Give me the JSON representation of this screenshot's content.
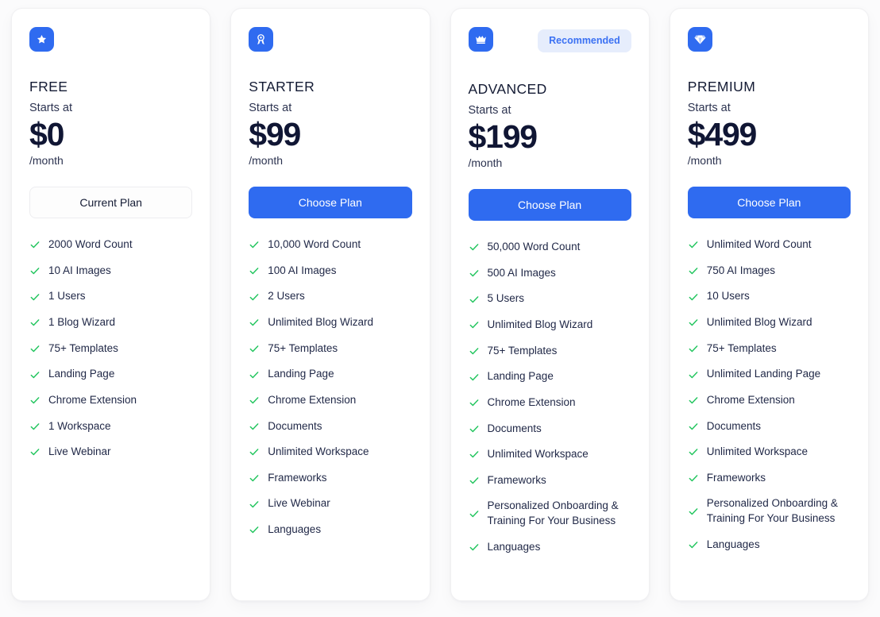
{
  "theme": {
    "page_background": "#fbfbfc",
    "card_background": "#ffffff",
    "accent_blue": "#2f6bf0",
    "badge_background": "#e6edfc",
    "badge_text": "#3b71f3",
    "check_green": "#22c55e",
    "heading_color": "#141b34"
  },
  "plans": [
    {
      "id": "free",
      "name": "FREE",
      "icon": "star-icon",
      "starts_at_label": "Starts at",
      "price": "$0",
      "period": "/month",
      "badge": "",
      "cta_label": "Current Plan",
      "cta_style": "outline",
      "features": [
        "2000 Word Count",
        "10 AI Images",
        "1 Users",
        "1 Blog Wizard",
        "75+ Templates",
        "Landing Page",
        "Chrome Extension",
        "1 Workspace",
        "Live Webinar"
      ]
    },
    {
      "id": "starter",
      "name": "STARTER",
      "icon": "medal-icon",
      "starts_at_label": "Starts at",
      "price": "$99",
      "period": "/month",
      "badge": "",
      "cta_label": "Choose Plan",
      "cta_style": "primary",
      "features": [
        "10,000 Word Count",
        "100 AI Images",
        "2 Users",
        "Unlimited Blog Wizard",
        "75+ Templates",
        "Landing Page",
        "Chrome Extension",
        "Documents",
        "Unlimited Workspace",
        "Frameworks",
        "Live Webinar",
        "Languages"
      ]
    },
    {
      "id": "advanced",
      "name": "ADVANCED",
      "icon": "crown-icon",
      "starts_at_label": "Starts at",
      "price": "$199",
      "period": "/month",
      "badge": "Recommended",
      "cta_label": "Choose Plan",
      "cta_style": "primary",
      "features": [
        "50,000 Word Count",
        "500 AI Images",
        "5 Users",
        "Unlimited Blog Wizard",
        "75+ Templates",
        "Landing Page",
        "Chrome Extension",
        "Documents",
        "Unlimited Workspace",
        "Frameworks",
        "Personalized Onboarding & Training For Your Business",
        "Languages"
      ]
    },
    {
      "id": "premium",
      "name": "PREMIUM",
      "icon": "diamond-icon",
      "starts_at_label": "Starts at",
      "price": "$499",
      "period": "/month",
      "badge": "",
      "cta_label": "Choose Plan",
      "cta_style": "primary",
      "features": [
        "Unlimited Word Count",
        "750 AI Images",
        "10 Users",
        "Unlimited Blog Wizard",
        "75+ Templates",
        "Unlimited Landing Page",
        "Chrome Extension",
        "Documents",
        "Unlimited Workspace",
        "Frameworks",
        "Personalized Onboarding & Training For Your Business",
        "Languages"
      ]
    }
  ]
}
